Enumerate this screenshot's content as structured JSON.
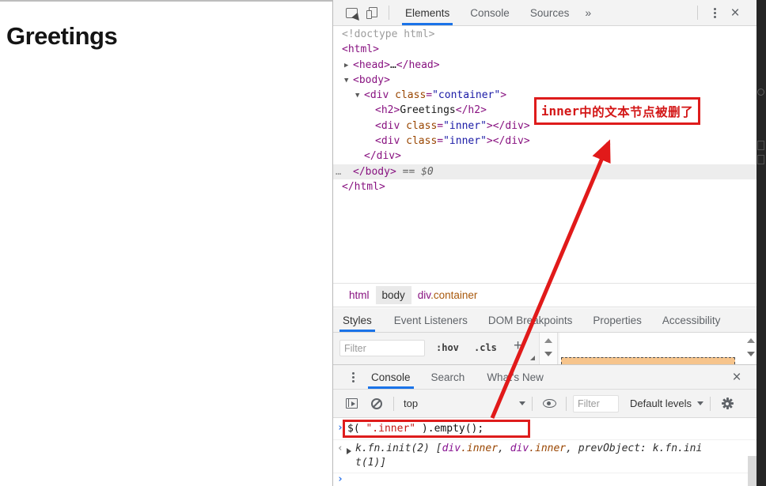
{
  "page": {
    "heading": "Greetings"
  },
  "annotation": {
    "label_en": "inner",
    "label_zh": "中的文本节点被删了"
  },
  "colors": {
    "accent_blue": "#1a73e8",
    "annotation_red": "#de1c1c",
    "tag_purple": "#881280",
    "attr_orange": "#994500",
    "value_blue": "#1a1aa6",
    "string_red": "#c41a16"
  },
  "devtools": {
    "main_tabs": {
      "items": [
        "Elements",
        "Console",
        "Sources"
      ],
      "more": "»",
      "active": "Elements"
    },
    "elements_tree": {
      "rows": [
        {
          "indent": 0,
          "arrow": "",
          "segs": [
            [
              "c-gr",
              "<!doctype html>"
            ]
          ]
        },
        {
          "indent": 0,
          "arrow": "",
          "segs": [
            [
              "c-tag",
              "<html>"
            ]
          ]
        },
        {
          "indent": 1,
          "arrow": "▶",
          "segs": [
            [
              "c-tag",
              "<head>"
            ],
            [
              "c-txt",
              "…"
            ],
            [
              "c-tag",
              "</head>"
            ]
          ]
        },
        {
          "indent": 1,
          "arrow": "▼",
          "segs": [
            [
              "c-tag",
              "<body>"
            ]
          ]
        },
        {
          "indent": 2,
          "arrow": "▼",
          "segs": [
            [
              "c-tag",
              "<div"
            ],
            [
              "c-attr",
              " class"
            ],
            [
              "c-tag",
              "="
            ],
            [
              "c-val",
              "\"container\""
            ],
            [
              "c-tag",
              ">"
            ]
          ]
        },
        {
          "indent": 3,
          "arrow": "",
          "segs": [
            [
              "c-tag",
              "<h2>"
            ],
            [
              "c-txt",
              "Greetings"
            ],
            [
              "c-tag",
              "</h2>"
            ]
          ]
        },
        {
          "indent": 3,
          "arrow": "",
          "segs": [
            [
              "c-tag",
              "<div"
            ],
            [
              "c-attr",
              " class"
            ],
            [
              "c-tag",
              "="
            ],
            [
              "c-val",
              "\"inner\""
            ],
            [
              "c-tag",
              "></div>"
            ]
          ]
        },
        {
          "indent": 3,
          "arrow": "",
          "segs": [
            [
              "c-tag",
              "<div"
            ],
            [
              "c-attr",
              " class"
            ],
            [
              "c-tag",
              "="
            ],
            [
              "c-val",
              "\"inner\""
            ],
            [
              "c-tag",
              "></div>"
            ]
          ]
        },
        {
          "indent": 2,
          "arrow": "",
          "segs": [
            [
              "c-tag",
              "</div>"
            ]
          ]
        },
        {
          "indent": 1,
          "arrow": "",
          "selected": true,
          "gutter": "…",
          "segs": [
            [
              "c-tag",
              "</body>"
            ],
            [
              "c-eq",
              " == $0"
            ]
          ]
        },
        {
          "indent": 0,
          "arrow": "",
          "segs": [
            [
              "c-tag",
              "</html>"
            ]
          ]
        }
      ]
    },
    "breadcrumbs": {
      "items": [
        {
          "selected": false,
          "segs": [
            [
              "cc-tag",
              "html"
            ]
          ]
        },
        {
          "selected": true,
          "segs": [
            [
              "cc-dark",
              "body"
            ]
          ]
        },
        {
          "selected": false,
          "segs": [
            [
              "cc-tag",
              "div"
            ],
            [
              "cc-cls",
              ".container"
            ]
          ]
        }
      ]
    },
    "styles_tabs": {
      "items": [
        "Styles",
        "Event Listeners",
        "DOM Breakpoints",
        "Properties",
        "Accessibility"
      ],
      "active": "Styles"
    },
    "styles_filterbar": {
      "filter_placeholder": "Filter",
      "hov_label": ":hov",
      "cls_label": ".cls",
      "plus_label": "+"
    },
    "console": {
      "tabs": {
        "items": [
          "Console",
          "Search",
          "What's New"
        ],
        "active": "Console"
      },
      "toolbar": {
        "context": "top",
        "filter_placeholder": "Filter",
        "levels_label": "Default levels"
      },
      "prompt_chevron": "›",
      "result_chevron": "‹",
      "command_segs": [
        [
          "c-cmd",
          "$( "
        ],
        [
          "c-str",
          "\".inner\""
        ],
        [
          "c-cmd",
          " ).empty();"
        ]
      ],
      "result_segs": [
        [
          "c-res",
          "k.fn.init(2) ["
        ],
        [
          "c-etag",
          "div"
        ],
        [
          "c-ecls",
          ".inner"
        ],
        [
          "c-res",
          ", "
        ],
        [
          "c-etag",
          "div"
        ],
        [
          "c-ecls",
          ".inner"
        ],
        [
          "c-res",
          ", prevObject: k.fn.init(1)]"
        ]
      ]
    }
  }
}
